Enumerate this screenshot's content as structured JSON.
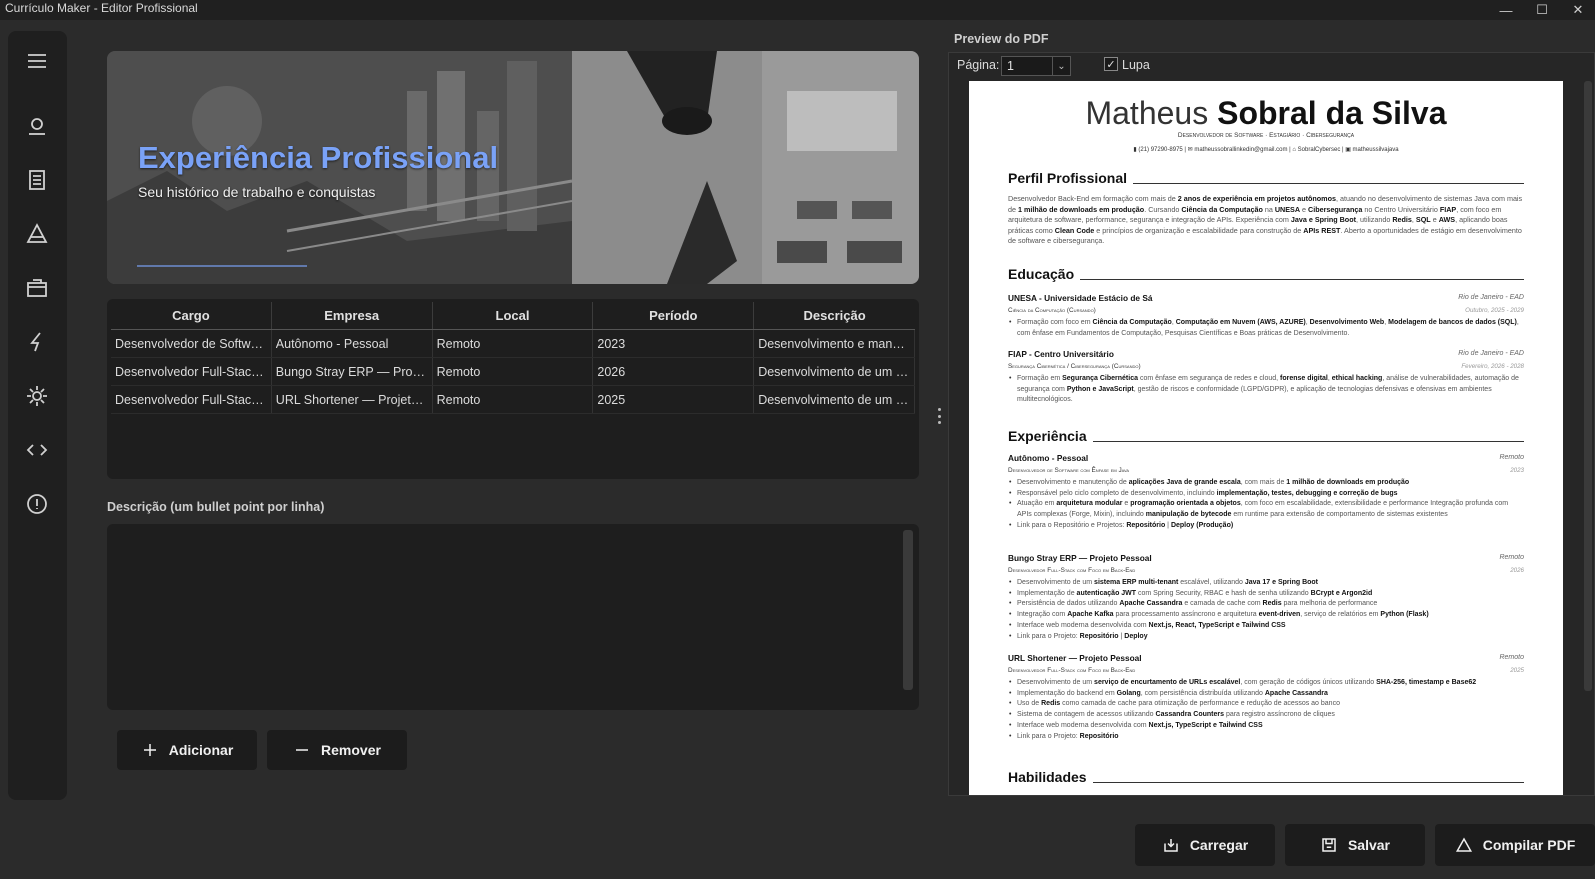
{
  "window": {
    "title": "Currículo Maker - Editor Profissional",
    "controls": [
      "—",
      "☐",
      "✕"
    ]
  },
  "sidebar": {
    "items": [
      "menu-icon",
      "user-icon",
      "document-icon",
      "triangle-icon",
      "briefcase-icon",
      "bolt-icon",
      "gear-icon",
      "code-icon",
      "info-icon"
    ]
  },
  "banner": {
    "title": "Experiência Profissional",
    "subtitle": "Seu histórico de trabalho e conquistas"
  },
  "table": {
    "columns": [
      "Cargo",
      "Empresa",
      "Local",
      "Período",
      "Descrição"
    ],
    "rows": [
      [
        "Desenvolvedor de Software...",
        "Autônomo - Pessoal",
        "Remoto",
        "2023",
        "Desenvolvimento e manut..."
      ],
      [
        "Desenvolvedor Full-Stack c...",
        "Bungo Stray ERP — Projeto...",
        "Remoto",
        "2026",
        "Desenvolvimento de um \\t..."
      ],
      [
        "Desenvolvedor Full-Stack c...",
        "URL Shortener — Projeto P...",
        "Remoto",
        "2025",
        "Desenvolvimento de um \\t..."
      ]
    ]
  },
  "description": {
    "label": "Descrição (um bullet point por linha)",
    "value": ""
  },
  "actions": {
    "add": "Adicionar",
    "remove": "Remover"
  },
  "preview": {
    "title": "Preview do PDF",
    "page_label": "Página:",
    "page_value": "1",
    "zoom_label": "Lupa",
    "zoom_checked": true
  },
  "footer": {
    "load": "Carregar",
    "save": "Salvar",
    "compile": "Compilar PDF"
  },
  "resume": {
    "name_first": "Matheus ",
    "name_last": "Sobral da Silva",
    "headline": "Desenvolvedor de Software · Estagiário · Cibersegurança",
    "contacts": "▮ (21) 97290-8975   |   ✉ matheussobrallinkedin@gmail.com   |   ⌂ SobralCybersec   |   ▣ matheussilvajava",
    "sections": {
      "profile": "Perfil Profissional",
      "education": "Educação",
      "experience": "Experiência",
      "skills": "Habilidades"
    },
    "profile_html": "Desenvolvedor Back-End em formação com mais de <b>2 anos de experiência em projetos autônomos</b>, atuando no desenvolvimento de sistemas Java com mais de <b>1 milhão de downloads em produção</b>. Cursando <b>Ciência da Computação</b> na <b>UNESA</b> e <b>Cibersegurança</b> no Centro Universitário <b>FIAP</b>, com foco em arquitetura de software, performance, segurança e integração de APIs. Experiência com <b>Java e Spring Boot</b>, utilizando <b>Redis</b>, <b>SQL</b> e <b>AWS</b>, aplicando boas práticas como <b>Clean Code</b> e princípios de organização e escalabilidade para construção de <b>APIs REST</b>. Aberto a oportunidades de estágio em desenvolvimento de software e cibersegurança.",
    "education": [
      {
        "org": "UNESA - Universidade Estácio de Sá",
        "loc": "Rio de Janeiro - EAD",
        "role": "Ciência da Computação (Cursando)",
        "date": "Outubro, 2025 - 2029",
        "bullets_html": [
          "Formação com foco em <b>Ciência da Computação</b>, <b>Computação em Nuvem (AWS, AZURE)</b>, <b>Desenvolvimento Web</b>, <b>Modelagem de bancos de dados (SQL)</b>, com ênfase em Fundamentos de Computação, Pesquisas Científicas e Boas práticas de Desenvolvimento."
        ]
      },
      {
        "org": "FIAP - Centro Universitário",
        "loc": "Rio de Janeiro - EAD",
        "role": "Segurança Cibernética / Cibersegurança (Cursando)",
        "date": "Fevereiro, 2026 - 2028",
        "bullets_html": [
          "Formação em <b>Segurança Cibernética</b> com ênfase em segurança de redes e cloud, <b>forense digital</b>, <b>ethical hacking</b>, análise de vulnerabilidades, automação de segurança com <b>Python e JavaScript</b>, gestão de riscos e conformidade (LGPD/GDPR), e aplicação de tecnologias defensivas e ofensivas em ambientes multitecnológicos."
        ]
      }
    ],
    "experience": [
      {
        "org": "Autônomo - Pessoal",
        "loc": "Remoto",
        "role": "Desenvolvedor de Software com Ênfase em Java",
        "date": "2023",
        "bullets_html": [
          "Desenvolvimento e manutenção de <b>aplicações Java de grande escala</b>, com mais de <b>1 milhão de downloads em produção</b>",
          "Responsável pelo ciclo completo de desenvolvimento, incluindo <b>implementação, testes, debugging e correção de bugs</b>",
          "Atuação em <b>arquitetura modular</b> e <b>programação orientada a objetos</b>, com foco em escalabilidade, extensibilidade e performance Integração profunda com APIs complexas (Forge, Mixin), incluindo <b>manipulação de bytecode</b> em runtime para extensão de comportamento de sistemas existentes",
          "Link para o Repositório e Projetos: <b>Repositório</b> | <b>Deploy (Produção)</b>"
        ]
      },
      {
        "org": "Bungo Stray ERP — Projeto Pessoal",
        "loc": "Remoto",
        "role": "Desenvolvedor Full-Stack com Foco em Back-End",
        "date": "2026",
        "bullets_html": [
          "Desenvolvimento de um <b>sistema ERP multi-tenant</b> escalável, utilizando <b>Java 17 e Spring Boot</b>",
          "Implementação de <b>autenticação JWT</b> com Spring Security, RBAC e hash de senha utilizando <b>BCrypt e Argon2id</b>",
          "Persistência de dados utilizando <b>Apache Cassandra</b> e camada de cache com <b>Redis</b> para melhoria de performance",
          "Integração com <b>Apache Kafka</b> para processamento assíncrono e arquitetura <b>event-driven</b>, serviço de relatórios em <b>Python (Flask)</b>",
          "Interface web moderna desenvolvida com <b>Next.js, React, TypeScript e Tailwind CSS</b>",
          "Link para o Projeto: <b>Repositório</b> | <b>Deploy</b>"
        ]
      },
      {
        "org": "URL Shortener — Projeto Pessoal",
        "loc": "Remoto",
        "role": "Desenvolvedor Full-Stack com Foco em Back-End",
        "date": "2025",
        "bullets_html": [
          "Desenvolvimento de um <b>serviço de encurtamento de URLs escalável</b>, com geração de códigos únicos utilizando <b>SHA-256, timestamp e Base62</b>",
          "Implementação do backend em <b>Golang</b>, com persistência distribuída utilizando <b>Apache Cassandra</b>",
          "Uso de <b>Redis</b> como camada de cache para otimização de performance e redução de acessos ao banco",
          "Sistema de contagem de acessos utilizando <b>Cassandra Counters</b> para registro assíncrono de cliques",
          "Interface web moderna desenvolvida com <b>Next.js, TypeScript e Tailwind CSS</b>",
          "Link para o Projeto: <b>Repositório</b>"
        ]
      }
    ]
  }
}
